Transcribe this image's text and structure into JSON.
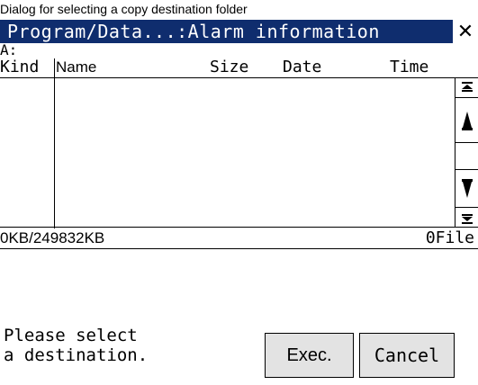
{
  "caption": "Dialog for selecting a copy destination folder",
  "dialog": {
    "title": "Program/Data...:Alarm information",
    "close_symbol": "✕",
    "drive": "A:",
    "columns": {
      "kind": "Kind",
      "name": "Name",
      "size": "Size",
      "date": "Date",
      "time": "Time"
    },
    "files": [],
    "scrollbar": {
      "top_icon": "scroll-to-top-icon",
      "up_icon": "scroll-up-icon",
      "down_icon": "scroll-down-icon",
      "bottom_icon": "scroll-to-bottom-icon"
    },
    "status": {
      "used": "0KB/249832KB",
      "count": "0File"
    },
    "message_line1": "Please select",
    "message_line2": "a destination.",
    "buttons": {
      "exec": "Exec.",
      "cancel": "Cancel"
    },
    "colors": {
      "titlebar": "#0f2d6e",
      "button_face": "#e3e3e3"
    }
  }
}
